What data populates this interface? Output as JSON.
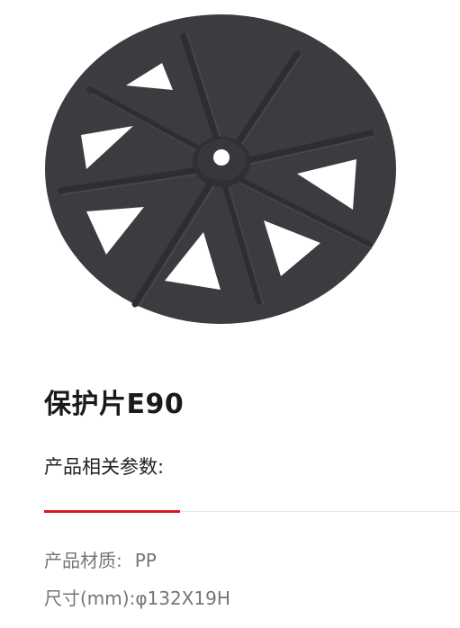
{
  "product": {
    "title": "保护片E90",
    "image_icon": "plastic-washer-disc-icon",
    "image_color": "#3a3c3f"
  },
  "params": {
    "heading": "产品相关参数:"
  },
  "divider": {
    "accent_color": "#d7191f"
  },
  "specs": {
    "material_label": "产品材质:",
    "material_value": "PP",
    "size_label": "尺寸(mm):",
    "size_value": "φ132X19H"
  }
}
